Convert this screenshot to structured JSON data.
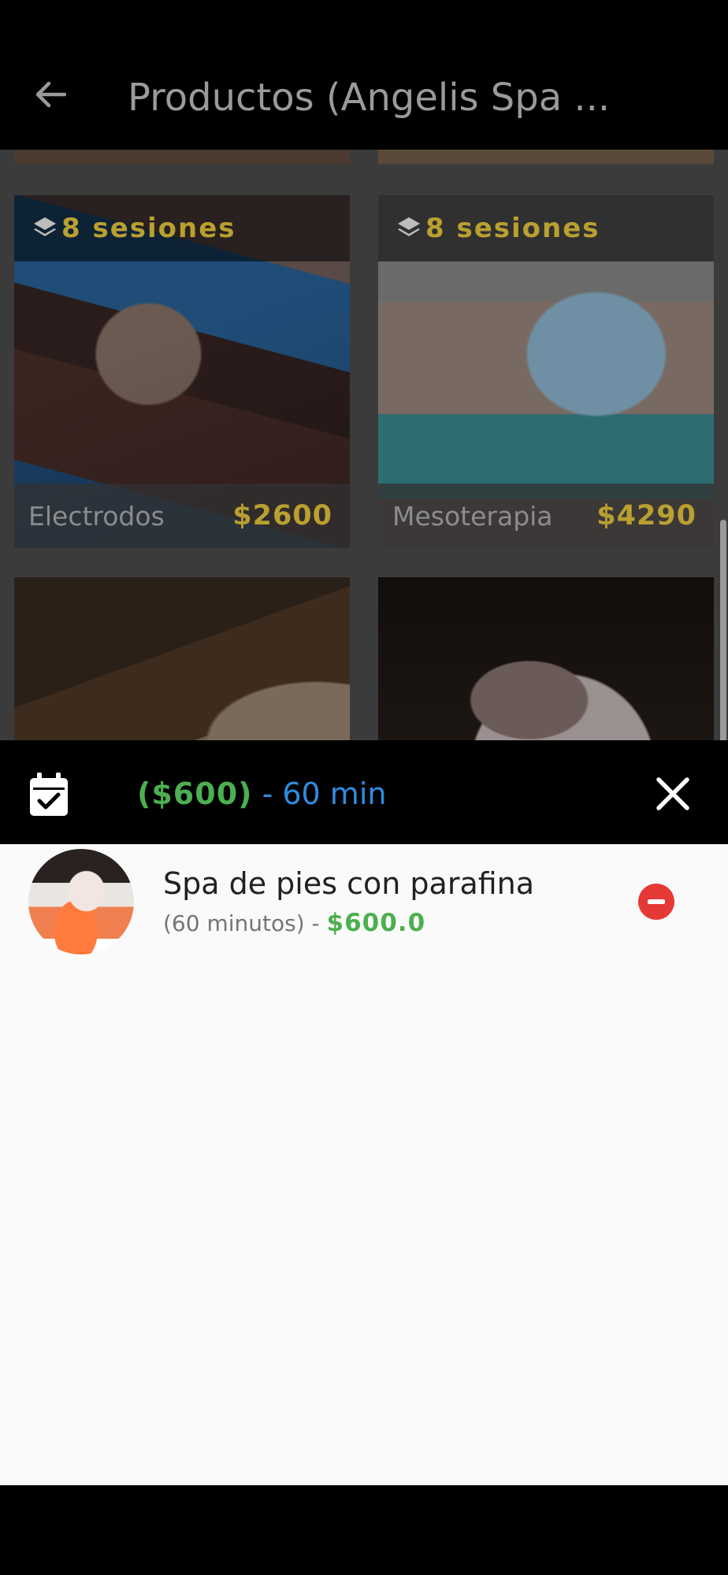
{
  "appbar": {
    "title": "Productos (Angelis Spa ...",
    "back_icon": "arrow-back-icon"
  },
  "products": [
    {
      "badge": "8 sesiones",
      "name": "Electrodos",
      "price": "$2600",
      "badge_icon": "layers-icon"
    },
    {
      "badge": "8 sesiones",
      "name": "Mesoterapia",
      "price": "$4290",
      "badge_icon": "layers-icon"
    }
  ],
  "summary": {
    "price": "($600)",
    "separator": " - ",
    "duration": "60 min",
    "calendar_icon": "calendar-check-icon",
    "close_icon": "close-icon"
  },
  "cart": {
    "items": [
      {
        "name": "Spa de pies con parafina",
        "duration": "(60 minutos) - ",
        "price": "$600.0",
        "remove_icon": "remove-circle-icon"
      }
    ]
  },
  "colors": {
    "price_gold": "#b9a030",
    "green": "#4caf50",
    "blue": "#2f8be0",
    "remove_red": "#e53935"
  }
}
